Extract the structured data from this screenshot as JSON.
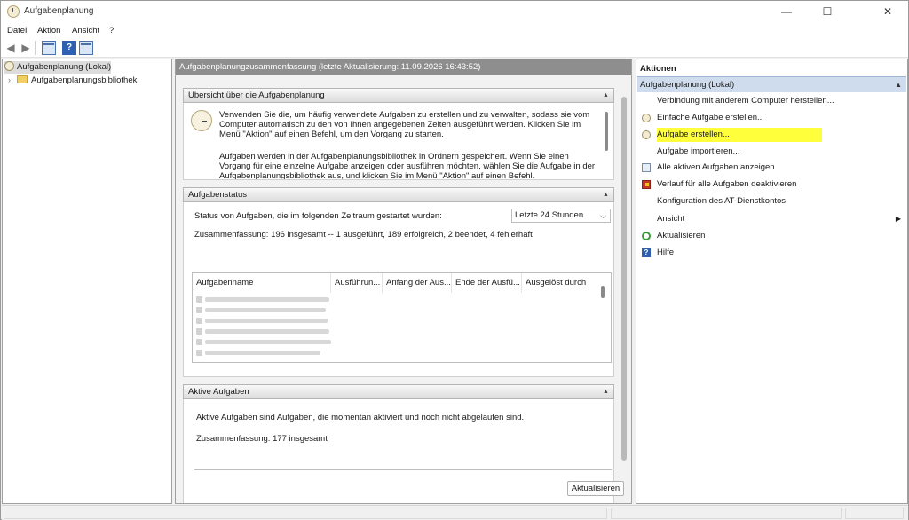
{
  "window": {
    "title": "Aufgabenplanung",
    "controls": {
      "minimize": "—",
      "maximize": "☐",
      "close": "✕"
    }
  },
  "menu": {
    "items": [
      "Datei",
      "Aktion",
      "Ansicht",
      "?"
    ]
  },
  "toolbar": {
    "help_glyph": "?"
  },
  "tree": {
    "root": "Aufgabenplanung (Lokal)",
    "child": "Aufgabenplanungsbibliothek"
  },
  "main": {
    "header": "Aufgabenplanungzusammenfassung (letzte Aktualisierung: 11.09.2026 16:43:52)",
    "overview": {
      "title": "Übersicht über die Aufgabenplanung",
      "para1": [
        "Verwenden Sie die, um häufig verwendete Aufgaben zu erstellen und zu verwalten, sodass sie vom",
        "Computer automatisch zu den von Ihnen angegebenen Zeiten ausgeführt werden. Klicken Sie im",
        "Menü \"Aktion\" auf einen Befehl, um den Vorgang zu starten."
      ],
      "para2": [
        "Aufgaben werden in der Aufgabenplanungsbibliothek in Ordnern gespeichert. Wenn Sie einen",
        "Vorgang für eine einzelne Aufgabe anzeigen oder ausführen möchten, wählen Sie die Aufgabe in der",
        "Aufgabenplanungsbibliothek aus, und klicken Sie im Menü \"Aktion\" auf einen Befehl."
      ]
    },
    "status": {
      "title": "Aufgabenstatus",
      "label": "Status von Aufgaben, die im folgenden Zeitraum gestartet wurden:",
      "period": "Letzte 24 Stunden",
      "summary": "Zusammenfassung: 196 insgesamt -- 1 ausgeführt, 189 erfolgreich, 2 beendet, 4 fehlerhaft",
      "columns": [
        "Aufgabenname",
        "Ausführun...",
        "Anfang der Aus...",
        "Ende der Ausfü...",
        "Ausgelöst durch"
      ]
    },
    "active": {
      "title": "Aktive Aufgaben",
      "desc": "Aktive Aufgaben sind Aufgaben, die momentan aktiviert und noch nicht abgelaufen sind.",
      "summary": "Zusammenfassung: 177 insgesamt"
    },
    "refresh_button": "Aktualisieren"
  },
  "actions": {
    "title": "Aktionen",
    "group": "Aufgabenplanung (Lokal)",
    "items": [
      {
        "label": "Verbindung mit anderem Computer herstellen...",
        "icon": "none"
      },
      {
        "label": "Einfache Aufgabe erstellen...",
        "icon": "clock-icon"
      },
      {
        "label": "Aufgabe erstellen...",
        "icon": "clock-icon"
      },
      {
        "label": "Aufgabe importieren...",
        "icon": "none"
      },
      {
        "label": "Alle aktiven Aufgaben anzeigen",
        "icon": "list-icon"
      },
      {
        "label": "Verlauf für alle Aufgaben deaktivieren",
        "icon": "book-icon"
      },
      {
        "label": "Konfiguration des AT-Dienstkontos",
        "icon": "none"
      },
      {
        "label": "Ansicht",
        "icon": "none",
        "submenu": "▶"
      },
      {
        "label": "Aktualisieren",
        "icon": "refresh-icon"
      },
      {
        "label": "Hilfe",
        "icon": "help-icon",
        "glyph": "?"
      }
    ]
  },
  "colors": {
    "highlight": "#ffff3c",
    "group_bg": "#cfdced",
    "header_bg": "#8e8e8e"
  }
}
